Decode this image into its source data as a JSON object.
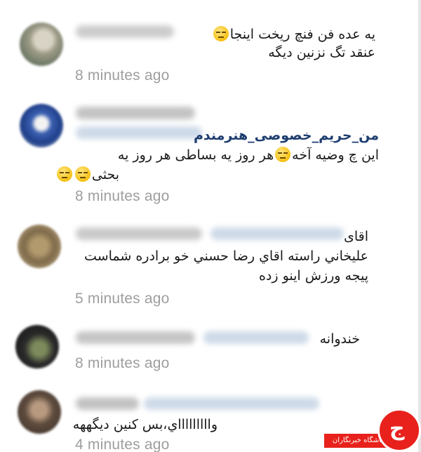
{
  "comments": [
    {
      "lines": [
        "یه عده فن فنچ ریخت اینجا",
        "عنقد تگ نزنین دیگه"
      ],
      "time": "8 minutes ago"
    },
    {
      "mention": "من_حریم_خصوصی_هنرمندم",
      "lines": [
        "این چ وضیه آخه",
        "هر روز یه بساطی هر روز یه",
        "بحثی"
      ],
      "time": "8 minutes ago"
    },
    {
      "lines": [
        "اقای",
        "عليخاني راسته اقاي رضا حسني خو برادره شماست",
        "پیجه ورزش اینو زده"
      ],
      "time": "5 minutes ago"
    },
    {
      "lines": [
        "خندوانه"
      ],
      "time": "8 minutes ago"
    },
    {
      "lines": [
        "واااااااااي،بس کنین دیگههه"
      ],
      "time": "4 minutes ago"
    }
  ],
  "logo": {
    "mark": "ج",
    "text": "باشگاه خبرنگاران"
  },
  "colors": {
    "timestamp": "#9e9e9e",
    "mention": "#1d3d6e",
    "logo": "#e8211c"
  },
  "icons": [
    "neutral-face-emoji-icon",
    "smile-face-emoji-icon",
    "sad-face-emoji-icon"
  ]
}
